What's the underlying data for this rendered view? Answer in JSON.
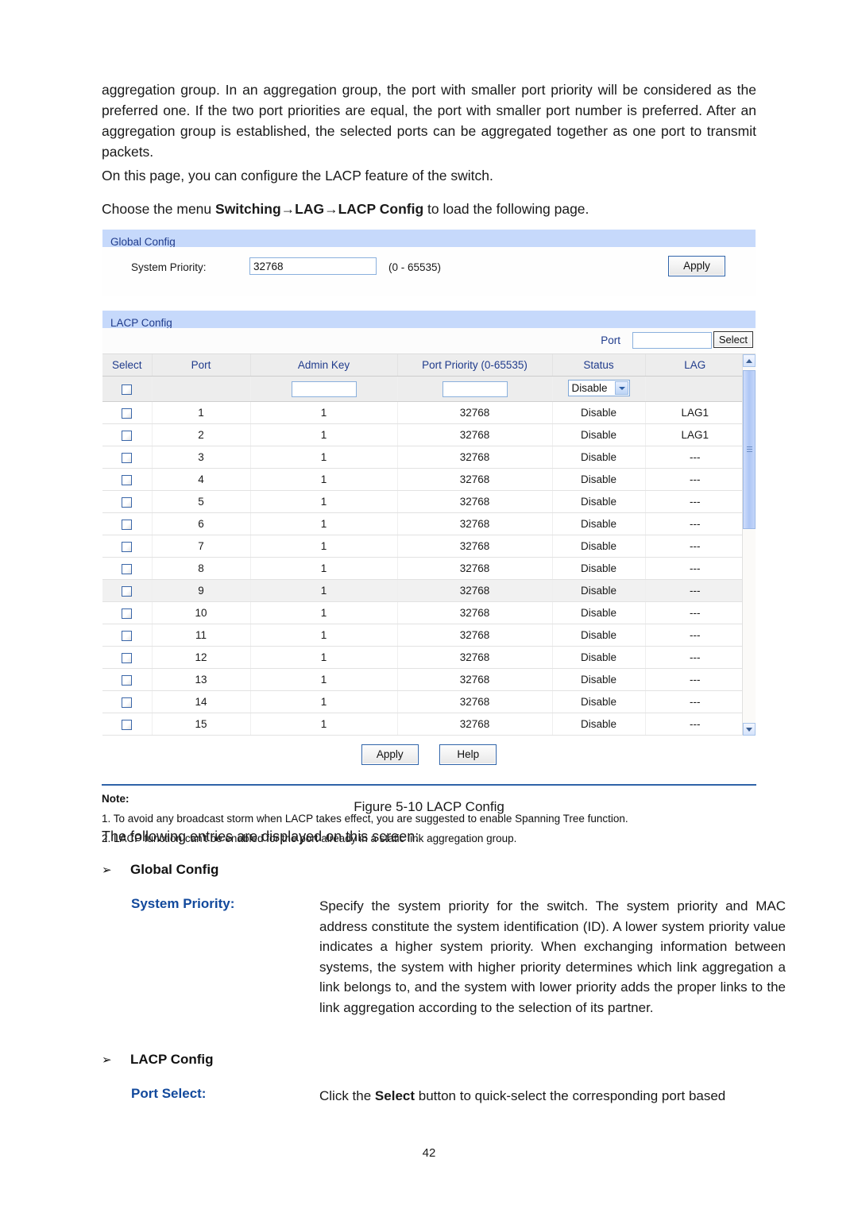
{
  "document": {
    "page_number": "42",
    "paragraphs": {
      "intro": "aggregation group. In an aggregation group, the port with smaller port priority will be considered as the preferred one. If the two port priorities are equal, the port with smaller port number is preferred. After an aggregation group is established, the selected ports can be aggregated together as one port to transmit packets.",
      "on_this_page": "On this page, you can configure the LACP feature of the switch.",
      "choose_menu_prefix": "Choose the menu ",
      "choose_menu_path": "Switching→LAG→LACP Config",
      "choose_menu_suffix": " to load the following page.",
      "following_entries": "The following entries are displayed on this screen:"
    },
    "figure_caption": "Figure 5-10 LACP Config"
  },
  "screenshot": {
    "global_config": {
      "title": "Global Config",
      "system_priority_label": "System Priority:",
      "system_priority_value": "32768",
      "system_priority_range": "(0 - 65535)",
      "apply_label": "Apply"
    },
    "lacp_config": {
      "title": "LACP Config",
      "port_search_label": "Port",
      "port_search_value": "",
      "select_button_label": "Select",
      "columns": [
        "Select",
        "Port",
        "Admin Key",
        "Port Priority (0-65535)",
        "Status",
        "LAG"
      ],
      "filter_row": {
        "admin_key_value": "",
        "port_priority_value": "",
        "status_value": "Disable"
      },
      "rows": [
        {
          "port": "1",
          "admin_key": "1",
          "port_priority": "32768",
          "status": "Disable",
          "lag": "LAG1",
          "highlight": false
        },
        {
          "port": "2",
          "admin_key": "1",
          "port_priority": "32768",
          "status": "Disable",
          "lag": "LAG1",
          "highlight": false
        },
        {
          "port": "3",
          "admin_key": "1",
          "port_priority": "32768",
          "status": "Disable",
          "lag": "---",
          "highlight": false
        },
        {
          "port": "4",
          "admin_key": "1",
          "port_priority": "32768",
          "status": "Disable",
          "lag": "---",
          "highlight": false
        },
        {
          "port": "5",
          "admin_key": "1",
          "port_priority": "32768",
          "status": "Disable",
          "lag": "---",
          "highlight": false
        },
        {
          "port": "6",
          "admin_key": "1",
          "port_priority": "32768",
          "status": "Disable",
          "lag": "---",
          "highlight": false
        },
        {
          "port": "7",
          "admin_key": "1",
          "port_priority": "32768",
          "status": "Disable",
          "lag": "---",
          "highlight": false
        },
        {
          "port": "8",
          "admin_key": "1",
          "port_priority": "32768",
          "status": "Disable",
          "lag": "---",
          "highlight": false
        },
        {
          "port": "9",
          "admin_key": "1",
          "port_priority": "32768",
          "status": "Disable",
          "lag": "---",
          "highlight": true
        },
        {
          "port": "10",
          "admin_key": "1",
          "port_priority": "32768",
          "status": "Disable",
          "lag": "---",
          "highlight": false
        },
        {
          "port": "11",
          "admin_key": "1",
          "port_priority": "32768",
          "status": "Disable",
          "lag": "---",
          "highlight": false
        },
        {
          "port": "12",
          "admin_key": "1",
          "port_priority": "32768",
          "status": "Disable",
          "lag": "---",
          "highlight": false
        },
        {
          "port": "13",
          "admin_key": "1",
          "port_priority": "32768",
          "status": "Disable",
          "lag": "---",
          "highlight": false
        },
        {
          "port": "14",
          "admin_key": "1",
          "port_priority": "32768",
          "status": "Disable",
          "lag": "---",
          "highlight": false
        },
        {
          "port": "15",
          "admin_key": "1",
          "port_priority": "32768",
          "status": "Disable",
          "lag": "---",
          "highlight": false
        }
      ],
      "apply_label": "Apply",
      "help_label": "Help"
    },
    "note": {
      "title": "Note:",
      "items": [
        "1. To avoid any broadcast storm when LACP takes effect, you are suggested to enable Spanning Tree function.",
        "2. LACP function can't be enabled for the port already in a static link aggregation group."
      ]
    }
  },
  "entries": {
    "global_config_heading": "Global Config",
    "lacp_config_heading": "LACP Config",
    "arrow_glyph": "➢",
    "system_priority": {
      "label": "System Priority:",
      "description": "Specify the system priority for the switch. The system priority and MAC address constitute the system identification (ID). A lower system priority value indicates a higher system priority. When exchanging information between systems, the system with higher priority determines which link aggregation a link belongs to, and the system with lower priority adds the proper links to the link aggregation according to the selection of its partner."
    },
    "port_select": {
      "label": "Port Select:",
      "text_before": "Click the ",
      "text_bold": "Select",
      "text_after": " button to quick-select the corresponding port based"
    }
  },
  "colors": {
    "panel_header_bg": "#c6d9fb",
    "panel_header_text": "#1f3b8c",
    "accent_blue": "#12499c",
    "table_header_bg": "#ededed",
    "button_border": "#2f63a8"
  }
}
